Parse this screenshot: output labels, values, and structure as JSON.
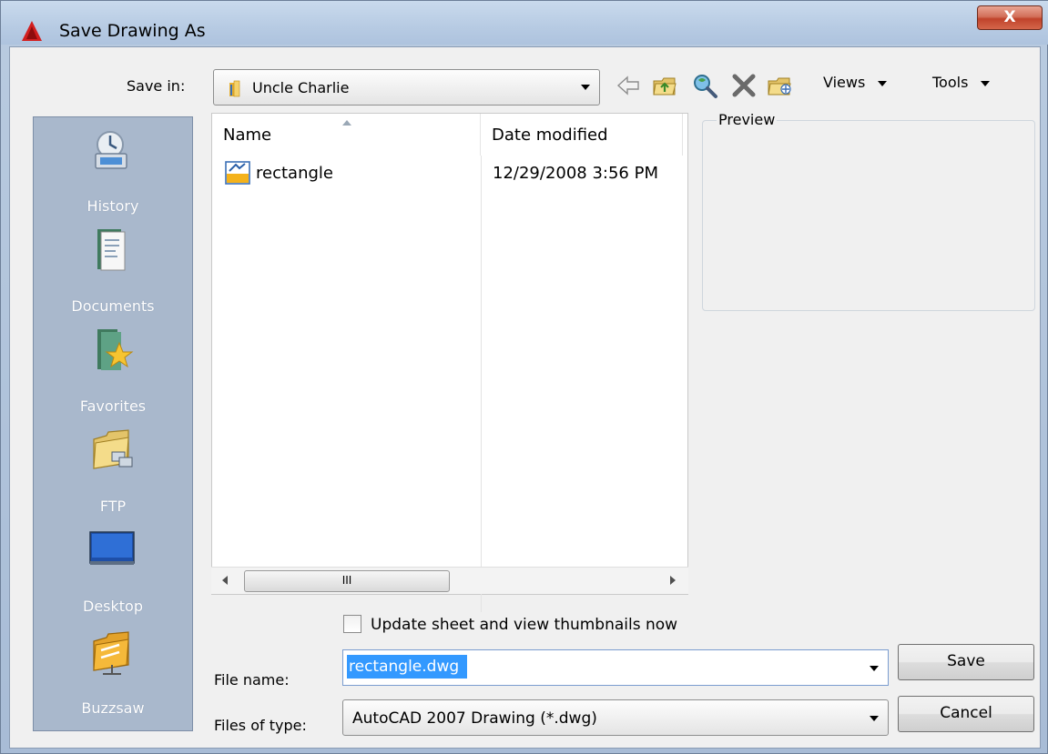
{
  "window": {
    "title": "Save Drawing As",
    "close_glyph": "X"
  },
  "toolbar": {
    "save_in_label": "Save in:",
    "save_in_value": "Uncle Charlie",
    "icons": [
      "back-icon",
      "up-folder-icon",
      "search-web-icon",
      "delete-icon",
      "create-folder-icon"
    ],
    "views_label": "Views",
    "tools_label": "Tools"
  },
  "places": [
    {
      "label": "History",
      "icon": "history-icon"
    },
    {
      "label": "Documents",
      "icon": "documents-icon"
    },
    {
      "label": "Favorites",
      "icon": "favorites-icon"
    },
    {
      "label": "FTP",
      "icon": "ftp-icon"
    },
    {
      "label": "Desktop",
      "icon": "desktop-icon"
    },
    {
      "label": "Buzzsaw",
      "icon": "buzzsaw-icon"
    }
  ],
  "file_list": {
    "columns": [
      "Name",
      "Date modified"
    ],
    "rows": [
      {
        "name": "rectangle",
        "date": "12/29/2008 3:56 PM"
      }
    ],
    "scroll_grip": "III"
  },
  "preview": {
    "label": "Preview"
  },
  "options": {
    "update_thumbnails_label": "Update sheet and view thumbnails now",
    "update_thumbnails_checked": false
  },
  "form": {
    "file_name_label": "File name:",
    "file_name_value": "rectangle.dwg",
    "file_type_label": "Files of type:",
    "file_type_value": "AutoCAD 2007 Drawing (*.dwg)"
  },
  "buttons": {
    "save": "Save",
    "cancel": "Cancel"
  },
  "colors": {
    "places_bg": "#a9b8cc",
    "selection": "#3399ff",
    "title_bar": "#b7cbe3",
    "close_button": "#c0432b"
  }
}
